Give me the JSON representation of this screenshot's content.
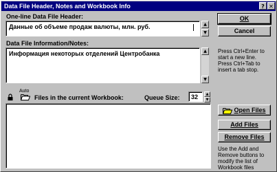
{
  "window": {
    "title": "Data File Header, Notes and Workbook Info",
    "help_glyph": "?",
    "close_glyph": "✕"
  },
  "header_field": {
    "label": "One-line Data File Header:",
    "value": "Данные об объеме продаж валюты, млн. руб."
  },
  "notes_field": {
    "label": "Data File Information/Notes:",
    "value": "Информация некоторых отделений Центробанка"
  },
  "buttons": {
    "ok": "OK",
    "cancel": "Cancel",
    "open_files": "Open Files",
    "add_files": "Add Files",
    "remove_files": "Remove Files"
  },
  "notes_hint": {
    "line1": "Press Ctrl+Enter to",
    "line2": "start a new line.",
    "line3": "Press Ctrl+Tab to",
    "line4": "insert a tab stop."
  },
  "workbook": {
    "auto_label": "Auto",
    "files_label": "Files in the current Workbook:",
    "queue_label": "Queue Size:",
    "queue_value": "32"
  },
  "add_remove_hint": {
    "line1": "Use the Add and",
    "line2": "Remove buttons to",
    "line3": "modify the list of",
    "line4": "Workbook files"
  }
}
